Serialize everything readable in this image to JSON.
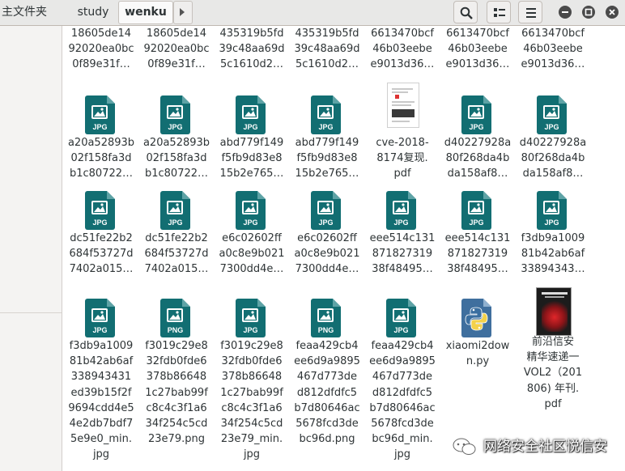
{
  "breadcrumb": {
    "home_label": "主文件夹",
    "items": [
      "study",
      "wenku"
    ]
  },
  "toolbar": {
    "search_icon": "search-icon",
    "view_options_icon": "view-options-icon",
    "menu_icon": "hamburger-menu-icon"
  },
  "window_controls": [
    "minimize-icon",
    "maximize-icon",
    "close-icon"
  ],
  "colors": {
    "image_icon_teal": "#126e72",
    "image_icon_fold": "#5ea3a6",
    "python_blue": "#3b6fa0",
    "python_yellow": "#f3d14a"
  },
  "files": [
    {
      "name": "18605de14\n92020ea0bc\n0f89e31f…",
      "type": "cut"
    },
    {
      "name": "18605de14\n92020ea0bc\n0f89e31f…",
      "type": "cut"
    },
    {
      "name": "435319b5fd\n39c48aa69d\n5c1610d2…",
      "type": "cut"
    },
    {
      "name": "435319b5fd\n39c48aa69d\n5c1610d2…",
      "type": "cut"
    },
    {
      "name": "6613470bcf\n46b03eebe\ne9013d36…",
      "type": "cut"
    },
    {
      "name": "6613470bcf\n46b03eebe\ne9013d36…",
      "type": "cut"
    },
    {
      "name": "6613470bcf\n46b03eebe\ne9013d36…",
      "type": "cut"
    },
    {
      "name": "a20a52893b\n02f158fa3d\nb1c80722…",
      "type": "jpg",
      "badge": "JPG"
    },
    {
      "name": "a20a52893b\n02f158fa3d\nb1c80722…",
      "type": "jpg",
      "badge": "JPG"
    },
    {
      "name": "abd779f149\nf5fb9d83e8\n15b2e765…",
      "type": "jpg",
      "badge": "JPG"
    },
    {
      "name": "abd779f149\nf5fb9d83e8\n15b2e765…",
      "type": "jpg",
      "badge": "JPG"
    },
    {
      "name": "cve-2018-\n8174复现.\npdf",
      "type": "pdf"
    },
    {
      "name": "d40227928a\n80f268da4b\nda158af8…",
      "type": "jpg",
      "badge": "JPG"
    },
    {
      "name": "d40227928a\n80f268da4b\nda158af8…",
      "type": "jpg",
      "badge": "JPG"
    },
    {
      "name": "dc51fe22b2\n684f53727d\n7402a015…",
      "type": "jpg",
      "badge": "JPG"
    },
    {
      "name": "dc51fe22b2\n684f53727d\n7402a015…",
      "type": "jpg",
      "badge": "JPG"
    },
    {
      "name": "e6c02602ff\na0c8e9b021\n7300dd4e…",
      "type": "jpg",
      "badge": "JPG"
    },
    {
      "name": "e6c02602ff\na0c8e9b021\n7300dd4e…",
      "type": "jpg",
      "badge": "JPG"
    },
    {
      "name": "eee514c131\n871827319\n38f48495…",
      "type": "jpg",
      "badge": "JPG"
    },
    {
      "name": "eee514c131\n871827319\n38f48495…",
      "type": "jpg",
      "badge": "JPG"
    },
    {
      "name": "f3db9a1009\n81b42ab6af\n33894343…",
      "type": "jpg",
      "badge": "JPG"
    },
    {
      "name": "f3db9a1009\n81b42ab6af\n338943431\ned39b15f2f\n9694cdd4e5\n4e2db7bdf7\n5e9e0_min.\njpg",
      "type": "jpg",
      "badge": "JPG"
    },
    {
      "name": "f3019c29e8\n32fdb0fde6\n378b86648\n1c27bab99f\nc8c4c3f1a6\n34f254c5cd\n23e79.png",
      "type": "png",
      "badge": "PNG"
    },
    {
      "name": "f3019c29e8\n32fdb0fde6\n378b86648\n1c27bab99f\nc8c4c3f1a6\n34f254c5cd\n23e79_min.\njpg",
      "type": "jpg",
      "badge": "JPG"
    },
    {
      "name": "feaa429cb4\nee6d9a9895\n467d773de\nd812dfdfc5\nb7d80646ac\n5678fcd3de\nbc96d.png",
      "type": "png",
      "badge": "PNG"
    },
    {
      "name": "feaa429cb4\nee6d9a9895\n467d773de\nd812dfdfc5\nb7d80646ac\n5678fcd3de\nbc96d_min.\njpg",
      "type": "jpg",
      "badge": "JPG"
    },
    {
      "name": "xiaomi2dow\nn.py",
      "type": "py"
    },
    {
      "name": "前沿信安\n精华速递一\nVOL2（201\n806) 年刊.\npdf",
      "type": "book"
    }
  ],
  "watermark": "网络安全社区悦信安"
}
